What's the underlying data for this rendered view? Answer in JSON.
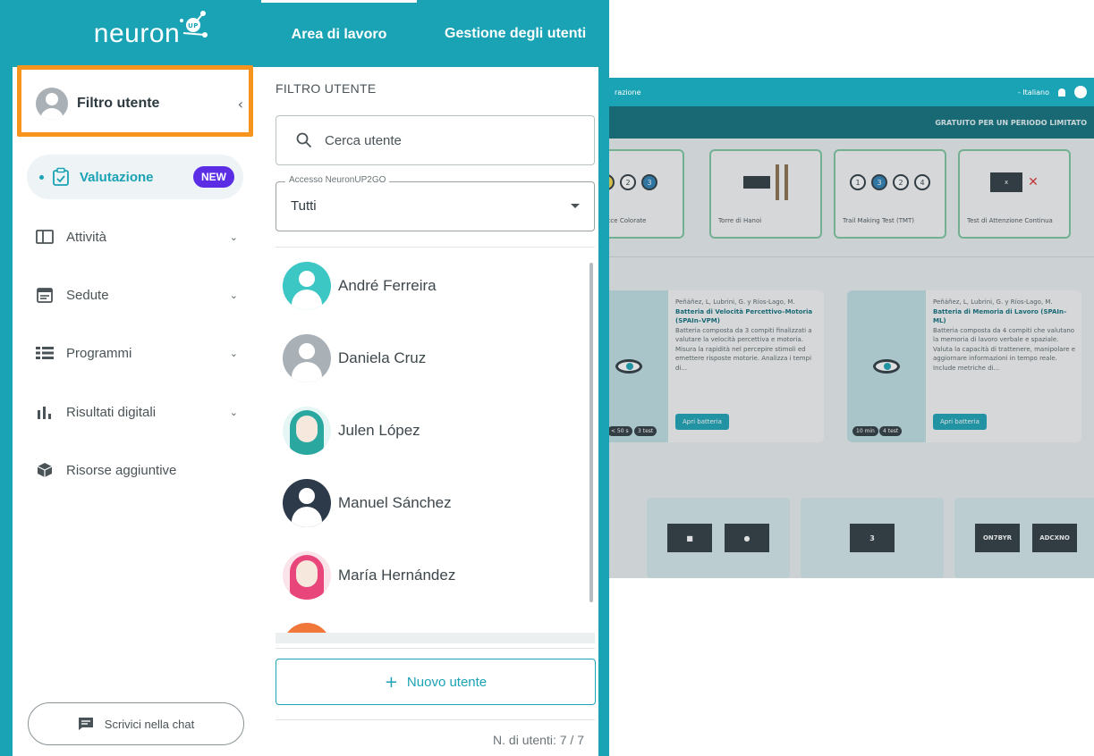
{
  "background_app": {
    "breadcrumb": "razione",
    "language": "- Italiano",
    "promo": "GRATUITO PER UN PERIODO LIMITATO",
    "tests": [
      {
        "label": "delle Tracce Colorate"
      },
      {
        "label": "Torre di Hanoi"
      },
      {
        "label": "Trail Making Test (TMT)"
      },
      {
        "label": "Test di Attenzione Continua"
      }
    ],
    "batteries": [
      {
        "authors": "Peñáñez, L, Lubrini, G. y Ríos-Lago, M.",
        "title": "Batteria di Velocità Percettivo–Motoria (SPAIn–VPM)",
        "desc": "Batteria composta da 3 compiti finalizzati a valutare la velocità percettiva e motoria. Misura la rapidità nel percepire stimoli ed emettere risposte motorie. Analizza i tempi di...",
        "button": "Apri batteria",
        "chips": [
          "< 50 s",
          "3 test"
        ]
      },
      {
        "authors": "Peñáñez, L, Lubrini, G. y Ríos-Lago, M.",
        "title": "Batteria di Memoria di Lavoro (SPAIn–ML)",
        "desc": "Batteria composta da 4 compiti che valutano la memoria di lavoro verbale e spaziale. Valuta la capacità di trattenere, manipolare e aggiornare informazioni in tempo reale. Include metriche di...",
        "button": "Apri batteria",
        "chips": [
          "10 min",
          "4 test"
        ]
      }
    ],
    "tiles": [
      {
        "screen": "■",
        "screen2": "●"
      },
      {
        "screen": "3"
      },
      {
        "screen": "ON7BYR",
        "screen2": "ADCXNO"
      }
    ]
  },
  "brand": {
    "logo_text": "neuron",
    "logo_badge": "UP"
  },
  "sidebar": {
    "filter_label": "Filtro utente",
    "active_item": {
      "label": "Valutazione",
      "badge": "NEW"
    },
    "items": [
      {
        "label": "Attività",
        "icon": "tablet-icon"
      },
      {
        "label": "Sedute",
        "icon": "calendar-icon"
      },
      {
        "label": "Programmi",
        "icon": "list-icon"
      },
      {
        "label": "Risultati digitali",
        "icon": "bar-chart-icon"
      },
      {
        "label": "Risorse aggiuntive",
        "icon": "box-icon"
      }
    ],
    "chat_label": "Scrivici nella chat"
  },
  "tabs": [
    {
      "label": "Area di lavoro",
      "active": true
    },
    {
      "label": "Gestione degli utenti",
      "active": false
    }
  ],
  "panel": {
    "title": "FILTRO UTENTE",
    "search_placeholder": "Cerca utente",
    "select_legend": "Accesso NeuronUP2GO",
    "select_value": "Tutti",
    "users": [
      {
        "name": "André Ferreira",
        "avatar_color": "#3cc6c4"
      },
      {
        "name": "Daniela Cruz",
        "avatar_color": "#a9b0b6"
      },
      {
        "name": "Julen López",
        "avatar_color": "#2aa8a0"
      },
      {
        "name": "Manuel Sánchez",
        "avatar_color": "#2d3a4a"
      },
      {
        "name": "María Hernández",
        "avatar_color": "#e8457a"
      }
    ],
    "new_user_label": "Nuovo utente",
    "user_count": "N. di utenti: 7 / 7"
  },
  "colors": {
    "primary": "#1aa3b5",
    "highlight": "#f7941d",
    "badge": "#5b2ee6"
  }
}
